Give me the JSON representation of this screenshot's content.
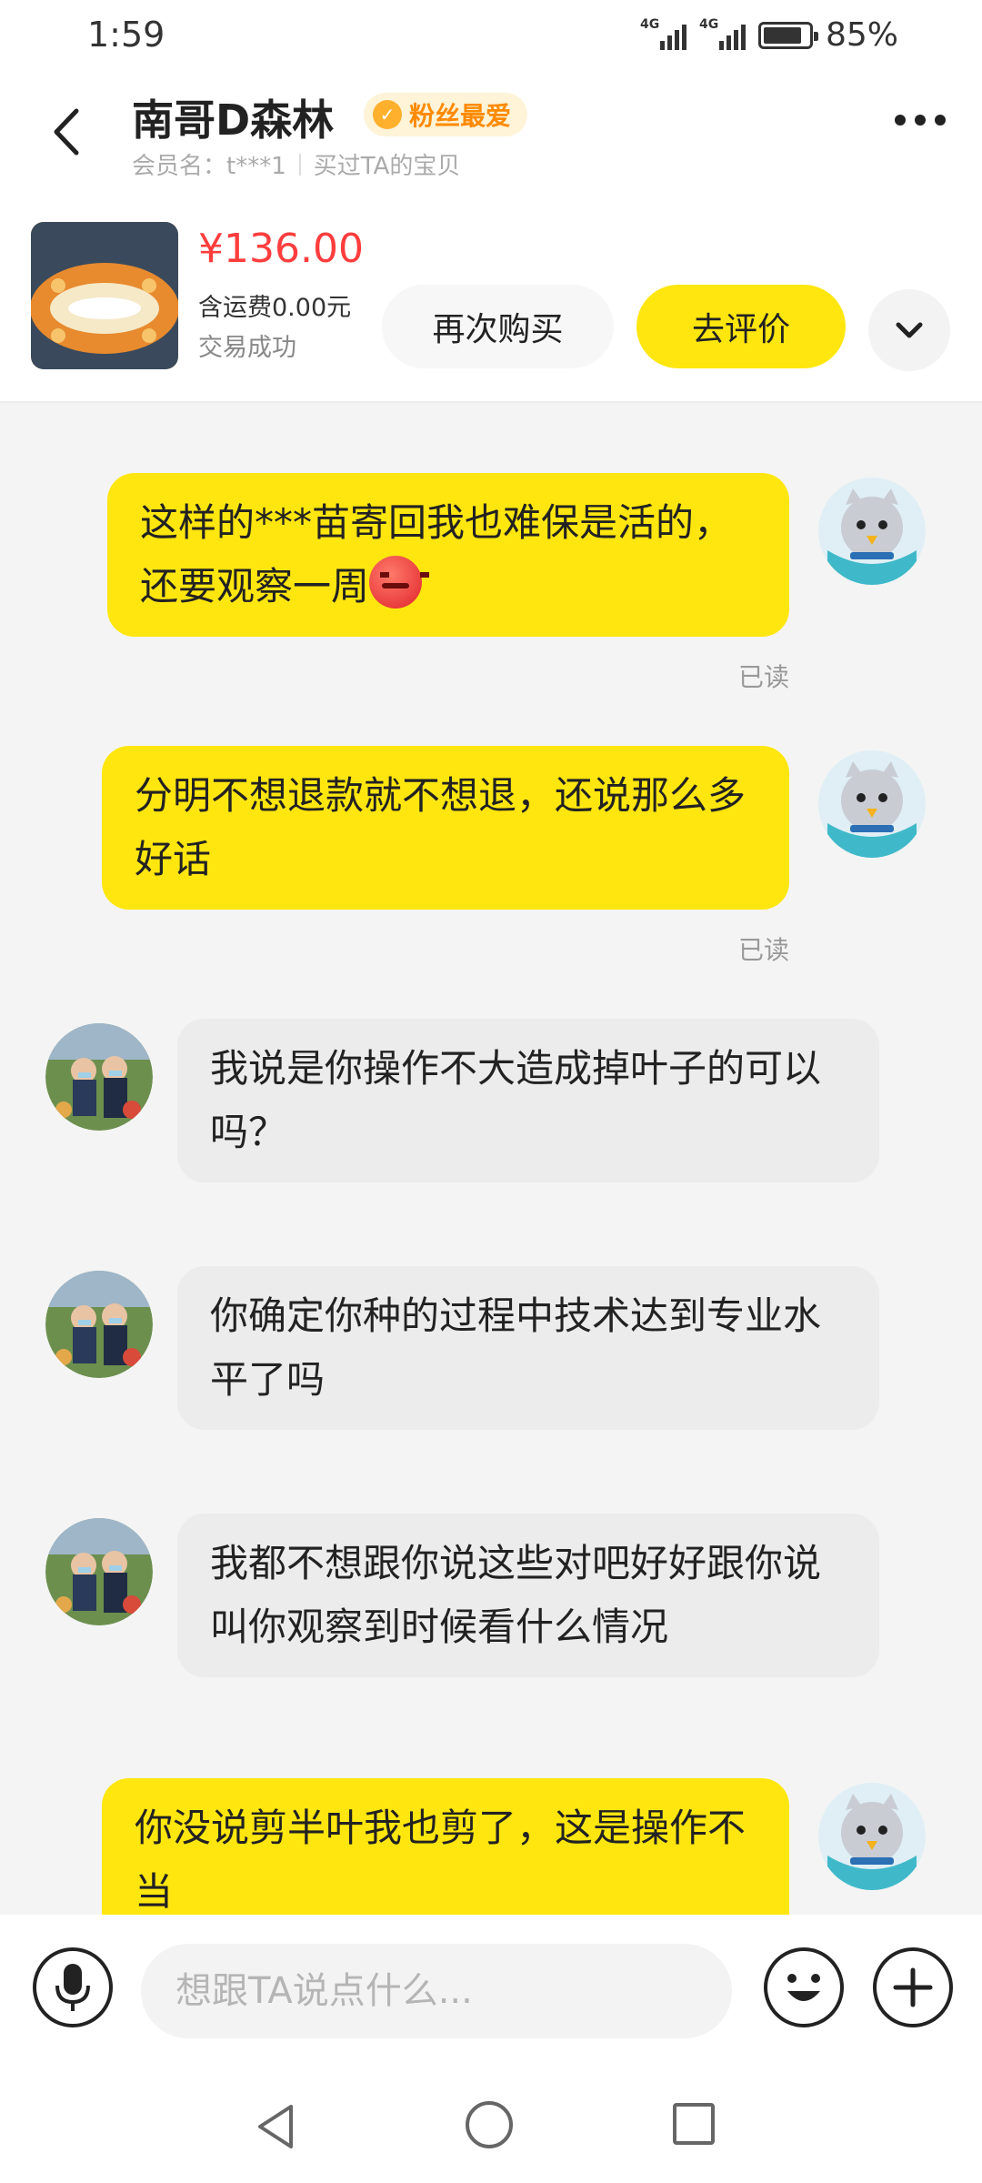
{
  "status_bar": {
    "time": "1:59",
    "network1": "4G",
    "network2": "4G",
    "battery": "85%"
  },
  "header": {
    "title": "南哥D森林",
    "badge": "粉丝最爱",
    "member_label": "会员名：t***1",
    "bought_label": "买过TA的宝贝"
  },
  "order": {
    "price": "¥136.00",
    "shipping": "含运费0.00元",
    "status": "交易成功",
    "rebuy_label": "再次购买",
    "review_label": "去评价"
  },
  "messages": [
    {
      "from": "me",
      "text": "这样的***苗寄回我也难保是活的，还要观察一周",
      "emoji": "angry-face",
      "read": "已读"
    },
    {
      "from": "me",
      "text": "分明不想退款就不想退，还说那么多好话",
      "read": "已读"
    },
    {
      "from": "them",
      "text": "我说是你操作不大造成掉叶子的可以吗？"
    },
    {
      "from": "them",
      "text": "你确定你种的过程中技术达到专业水平了吗"
    },
    {
      "from": "them",
      "text": "我都不想跟你说这些对吧好好跟你说叫你观察到时候看什么情况"
    },
    {
      "from": "me",
      "text": "你没说剪半叶我也剪了，这是操作不当"
    }
  ],
  "input": {
    "placeholder": "想跟TA说点什么..."
  },
  "colors": {
    "accent_yellow": "#ffe60f",
    "price_red": "#ff3d3d",
    "badge_orange": "#ff8a00"
  }
}
